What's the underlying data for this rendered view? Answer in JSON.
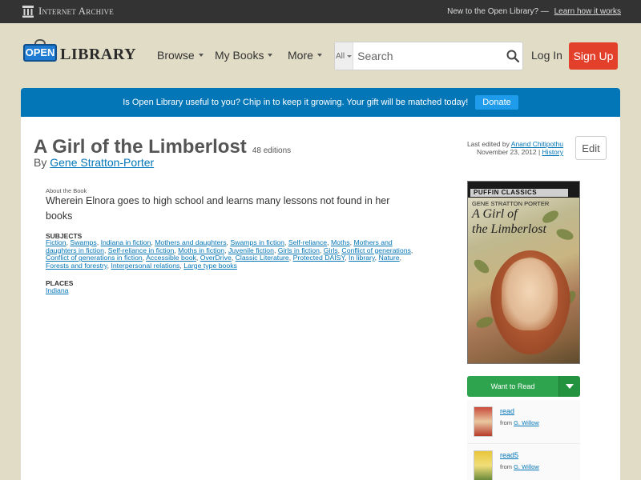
{
  "ia_bar": {
    "logo_text": "Internet Archive",
    "new_text": "New to the Open Library? —",
    "learn_link": "Learn how it works"
  },
  "header": {
    "logo_open": "OPEN",
    "logo_library": "LIBRARY",
    "nav": [
      {
        "label": "Browse"
      },
      {
        "label": "My Books"
      },
      {
        "label": "More"
      }
    ],
    "search": {
      "scope": "All",
      "placeholder": "Search"
    },
    "login": "Log In",
    "signup": "Sign Up"
  },
  "banner": {
    "text": "Is Open Library useful to you? Chip in to keep it growing. Your gift will be matched today!",
    "donate": "Donate",
    "color": "#0376b8"
  },
  "book": {
    "title": "A Girl of the Limberlost",
    "editions": "48 editions",
    "by": "By",
    "author": "Gene Stratton-Porter",
    "edited_prefix": "Last edited by",
    "editor": "Anand Chitipothu",
    "edit_date": "November 23, 2012 |",
    "history": "History",
    "edit_button": "Edit",
    "about_label": "About the Book",
    "about_text": "Wherein Elnora goes to high school and learns many lessons not found in her books",
    "subjects_label": "SUBJECTS",
    "subjects": [
      "Fiction",
      "Swamps",
      "Indiana in fiction",
      "Mothers and daughters",
      "Swamps in fiction",
      "Self-reliance",
      "Moths",
      "Mothers and daughters in fiction",
      "Self-reliance in fiction",
      "Moths in fiction",
      "Juvenile fiction",
      "Girls in fiction",
      "Girls",
      "Conflict of generations",
      "Conflict of generations in fiction",
      "Accessible book",
      "OverDrive",
      "Classic Literature",
      "Protected DAISY",
      "In library",
      "Nature",
      "Forests and forestry",
      "Interpersonal relations",
      "Large type books"
    ],
    "places_label": "PLACES",
    "places": [
      "Indiana"
    ]
  },
  "cover": {
    "series": "PUFFIN CLASSICS",
    "author": "GENE STRATTON PORTER",
    "title_line1": "A Girl of",
    "title_line2": "the Limberlost"
  },
  "sidebar": {
    "want_to_read": "Want to Read",
    "lists": [
      {
        "name": "read",
        "from": "from",
        "user": "G. Willow"
      },
      {
        "name": "read5",
        "from": "from",
        "user": "G. Willow"
      }
    ]
  }
}
